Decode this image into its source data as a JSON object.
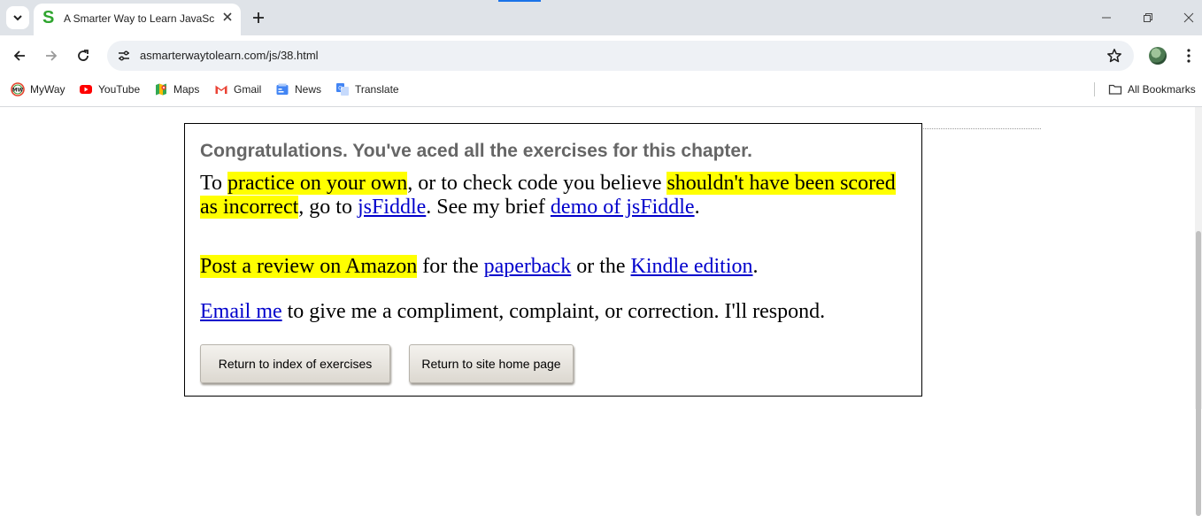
{
  "browser": {
    "tab": {
      "title": "A Smarter Way to Learn JavaScript",
      "favicon_letter": "S"
    },
    "url": "asmarterwaytolearn.com/js/38.html",
    "bookmarks": [
      {
        "label": "MyWay",
        "icon": "myway-icon"
      },
      {
        "label": "YouTube",
        "icon": "youtube-icon"
      },
      {
        "label": "Maps",
        "icon": "maps-icon"
      },
      {
        "label": "Gmail",
        "icon": "gmail-icon"
      },
      {
        "label": "News",
        "icon": "news-icon"
      },
      {
        "label": "Translate",
        "icon": "translate-icon"
      }
    ],
    "all_bookmarks_label": "All Bookmarks"
  },
  "page": {
    "heading": "Congratulations. You've aced all the exercises for this chapter.",
    "p1": {
      "t1": "To ",
      "h1": "practice on your own",
      "t2": ", or to check code you believe ",
      "h2": "shouldn't have been scored as incorrect",
      "t3": ", go to ",
      "link1": "jsFiddle",
      "t4": ". See my brief ",
      "link2": "demo of jsFiddle",
      "t5": "."
    },
    "p2": {
      "h1": "Post a review on Amazon",
      "t1": " for the ",
      "link1": "paperback",
      "t2": " or the ",
      "link2": "Kindle edition",
      "t3": "."
    },
    "p3": {
      "link1": "Email me",
      "t1": " to give me a compliment, complaint, or correction. I'll respond."
    },
    "buttons": {
      "index": "Return to index of exercises",
      "home": "Return to site home page"
    }
  },
  "colors": {
    "highlight": "#ffff00",
    "link": "#0000cc",
    "heading": "#666666",
    "favicon": "#2fa52f"
  }
}
